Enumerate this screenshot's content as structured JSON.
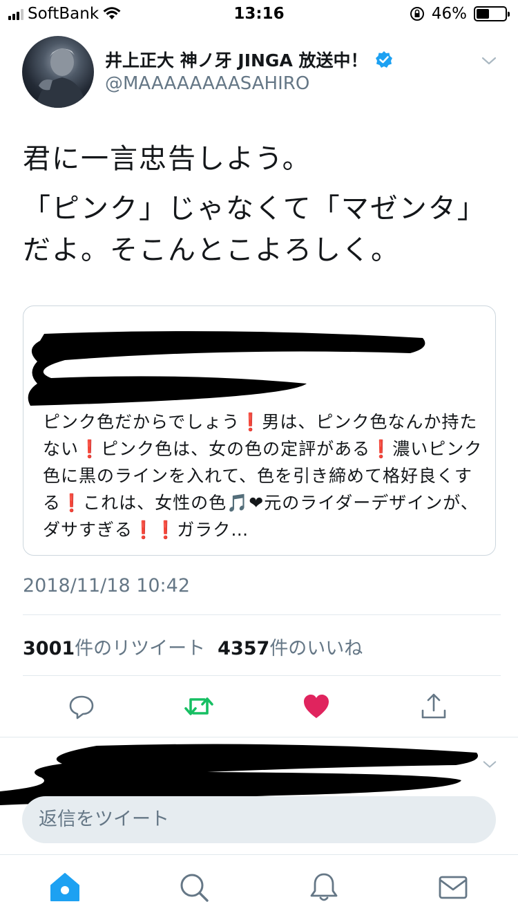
{
  "status_bar": {
    "carrier": "SoftBank",
    "time": "13:16",
    "battery_percent": "46%",
    "battery_level": 0.46
  },
  "tweet": {
    "display_name": "井上正大 神ノ牙 JINGA 放送中！",
    "handle": "@MAAAAAAAASAHIRO",
    "text_line1": "君に一言忠告しよう。",
    "text_line2": "「ピンク」じゃなくて「マゼンタ」だよ。そこんとこよろしく。",
    "timestamp": "2018/11/18 10:42"
  },
  "quote": {
    "text": "ピンク色だからでしょう❗男は、ピンク色なんか持たない❗ピンク色は、女の色の定評がある❗濃いピンク色に黒のラインを入れて、色を引き締めて格好良くする❗これは、女性の色🎵❤元のライダーデザインが、ダサすぎる❗❗ガラク…"
  },
  "stats": {
    "retweet_count": "3001",
    "retweet_label": "件のリツイート",
    "like_count": "4357",
    "like_label": "件のいいね"
  },
  "reply_box": {
    "placeholder": "返信をツイート"
  },
  "icons": {
    "reply": "reply-icon",
    "retweet": "retweet-icon",
    "like": "heart-icon",
    "share": "share-icon",
    "home": "home-icon",
    "search": "search-icon",
    "notifications": "bell-icon",
    "messages": "mail-icon"
  },
  "colors": {
    "accent": "#1da1f2",
    "retweet_green": "#17bf63",
    "like_red": "#e0245e",
    "secondary_text": "#657786"
  }
}
